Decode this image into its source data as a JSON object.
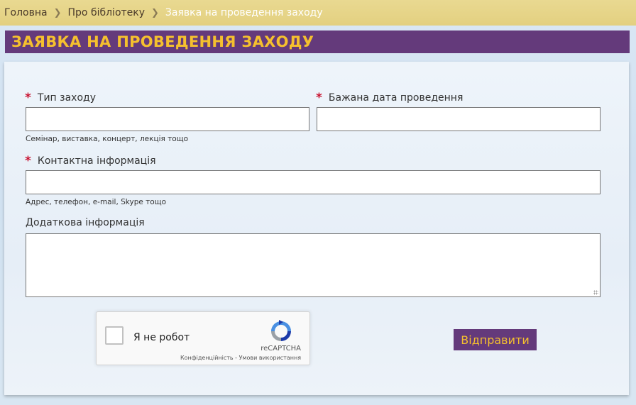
{
  "breadcrumb": {
    "items": [
      "Головна",
      "Про бібліотеку"
    ],
    "current": "Заявка на проведення заходу"
  },
  "page": {
    "title": "ЗАЯВКА НА ПРОВЕДЕННЯ ЗАХОДУ"
  },
  "form": {
    "required_mark": "*",
    "event_type": {
      "label": "Тип заходу",
      "value": "",
      "hint": "Семінар, виставка, концерт, лекція тощо"
    },
    "date": {
      "label": "Бажана дата проведення",
      "value": ""
    },
    "contact": {
      "label": "Контактна інформація",
      "value": "",
      "hint": "Адрес, телефон, e-mail, Skype тощо"
    },
    "extra": {
      "label": "Додаткова інформація",
      "value": ""
    },
    "submit_label": "Відправити"
  },
  "recaptcha": {
    "label": "Я не робот",
    "brand": "reCAPTCHA",
    "links": "Конфіденційність - Умови використання"
  },
  "colors": {
    "accent": "#643a7b",
    "title_text": "#f5c02e",
    "breadcrumb_bg": "#e6d487",
    "required": "#c8102e"
  }
}
